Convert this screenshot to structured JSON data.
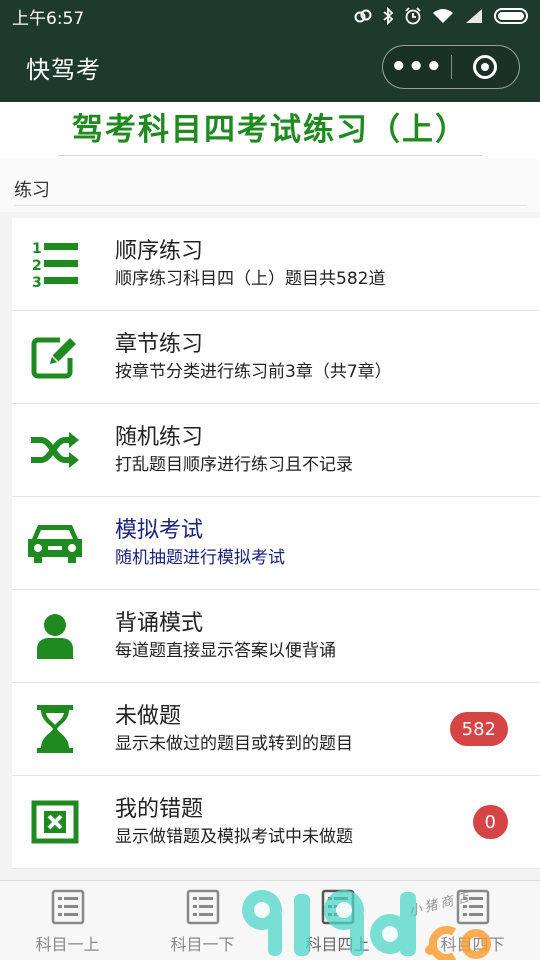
{
  "status_bar": {
    "time": "上午6:57",
    "icons": [
      "alarm-link-icon",
      "bluetooth-icon",
      "clock-icon",
      "wifi-icon",
      "signal-icon",
      "battery-icon"
    ]
  },
  "header": {
    "title": "快驾考",
    "more_label": "•••",
    "close_icon": "target-icon",
    "background": "#1e3a2d"
  },
  "banner": {
    "title": "驾考科目四考试练习（上）",
    "color": "#1f8a1f"
  },
  "section": {
    "title": "练习"
  },
  "menu": [
    {
      "title": "顺序练习",
      "subtitle": "顺序练习科目四（上）题目共582道",
      "icon": "numbered-list-icon"
    },
    {
      "title": "章节练习",
      "subtitle": "按章节分类进行练习前3章（共7章）",
      "icon": "edit-icon"
    },
    {
      "title": "随机练习",
      "subtitle": "打乱题目顺序进行练习且不记录",
      "icon": "shuffle-icon"
    },
    {
      "title": "模拟考试",
      "subtitle": "随机抽题进行模拟考试",
      "icon": "car-icon",
      "active": true
    },
    {
      "title": "背诵模式",
      "subtitle": "每道题直接显示答案以便背诵",
      "icon": "user-icon"
    },
    {
      "title": "未做题",
      "subtitle": "显示未做过的题目或转到的题目",
      "icon": "hourglass-icon",
      "badge": "582"
    },
    {
      "title": "我的错题",
      "subtitle": "显示做错题及模拟考试中未做题",
      "icon": "error-box-icon",
      "badge": "0"
    }
  ],
  "tabs": [
    {
      "label": "科目一上",
      "icon": "list-doc-icon"
    },
    {
      "label": "科目一下",
      "icon": "list-doc-icon"
    },
    {
      "label": "科目四上",
      "icon": "list-doc-icon",
      "active": true
    },
    {
      "label": "科目四下",
      "icon": "list-doc-icon"
    }
  ],
  "watermark": {
    "brand": "9188.com",
    "shop_text": "小猪商店"
  },
  "colors": {
    "accent_green": "#1f8a1f",
    "active_text": "#1a237e",
    "badge_red": "#d54545"
  }
}
